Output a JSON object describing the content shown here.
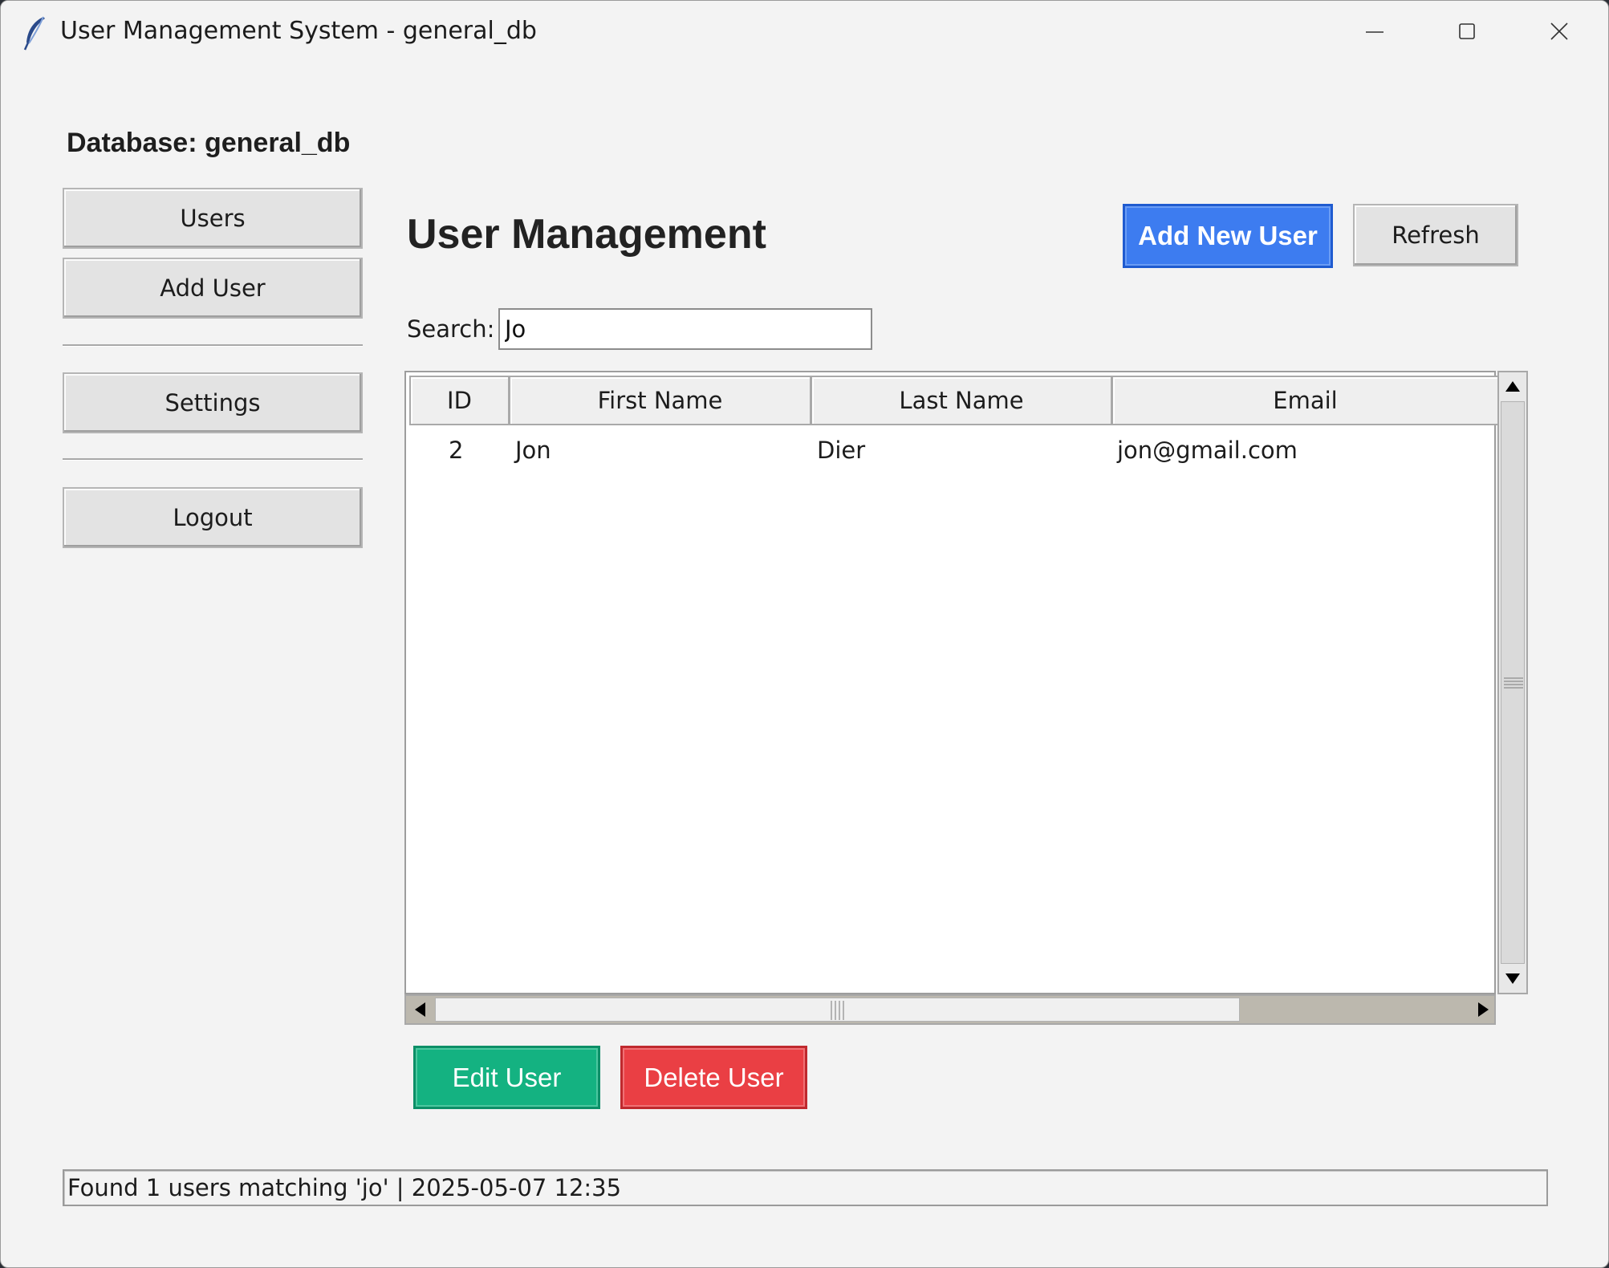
{
  "window": {
    "title": "User Management System - general_db"
  },
  "sidebar": {
    "db_label": "Database: general_db",
    "buttons": [
      {
        "label": "Users"
      },
      {
        "label": "Add User"
      },
      {
        "label": "Settings"
      },
      {
        "label": "Logout"
      }
    ]
  },
  "main": {
    "title": "User Management",
    "add_button": "Add New User",
    "refresh_button": "Refresh",
    "search": {
      "label": "Search:",
      "value": "Jo"
    },
    "table": {
      "columns": [
        "ID",
        "First Name",
        "Last Name",
        "Email"
      ],
      "rows": [
        {
          "id": "2",
          "first_name": "Jon",
          "last_name": "Dier",
          "email": "jon@gmail.com"
        }
      ]
    },
    "edit_button": "Edit User",
    "delete_button": "Delete User"
  },
  "status_bar": "Found 1 users matching 'jo' | 2025-05-07 12:35",
  "icons": {
    "app": "feather-icon",
    "minimize": "minimize-icon",
    "maximize": "maximize-icon",
    "close": "close-icon"
  },
  "colors": {
    "add_button": "#3d7cf0",
    "edit_button": "#14b281",
    "delete_button": "#ea3f44"
  }
}
